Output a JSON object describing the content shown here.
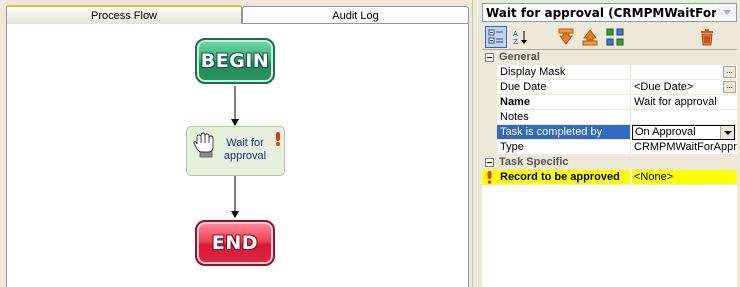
{
  "tabs": [
    {
      "label": "Process Flow",
      "active": true
    },
    {
      "label": "Audit Log",
      "active": false
    }
  ],
  "flow": {
    "begin_label": "BEGIN",
    "task_label_line1": "Wait for",
    "task_label_line2": "approval",
    "end_label": "END"
  },
  "properties": {
    "selected_object": "Wait for approval (CRMPMWaitForApp",
    "categories": [
      {
        "label": "General",
        "rows": [
          {
            "name": "Display Mask",
            "value": "",
            "has_ellipsis": true
          },
          {
            "name": "Due Date",
            "value": "<Due Date>",
            "has_ellipsis": true
          },
          {
            "name": "Name",
            "value": "Wait for approval",
            "bold": true
          },
          {
            "name": "Notes",
            "value": ""
          },
          {
            "name": "Task is completed by",
            "value": "On Approval",
            "selected": true
          },
          {
            "name": "Type",
            "value": "CRMPMWaitForAppr"
          }
        ]
      },
      {
        "label": "Task Specific",
        "rows": [
          {
            "name": "Record to be approved",
            "value": "<None>",
            "bold": true,
            "required": true
          }
        ]
      }
    ]
  },
  "icons": {
    "toolbar": [
      "categorized-icon",
      "alphabetical-icon",
      "move-down-icon",
      "move-up-icon",
      "add-block-icon",
      "delete-icon"
    ],
    "task": [
      "hand-icon",
      "warning-icon"
    ]
  },
  "colors": {
    "selection": "#316ac5",
    "required_highlight": "#ffff00",
    "task_text": "#1a2c8a"
  }
}
